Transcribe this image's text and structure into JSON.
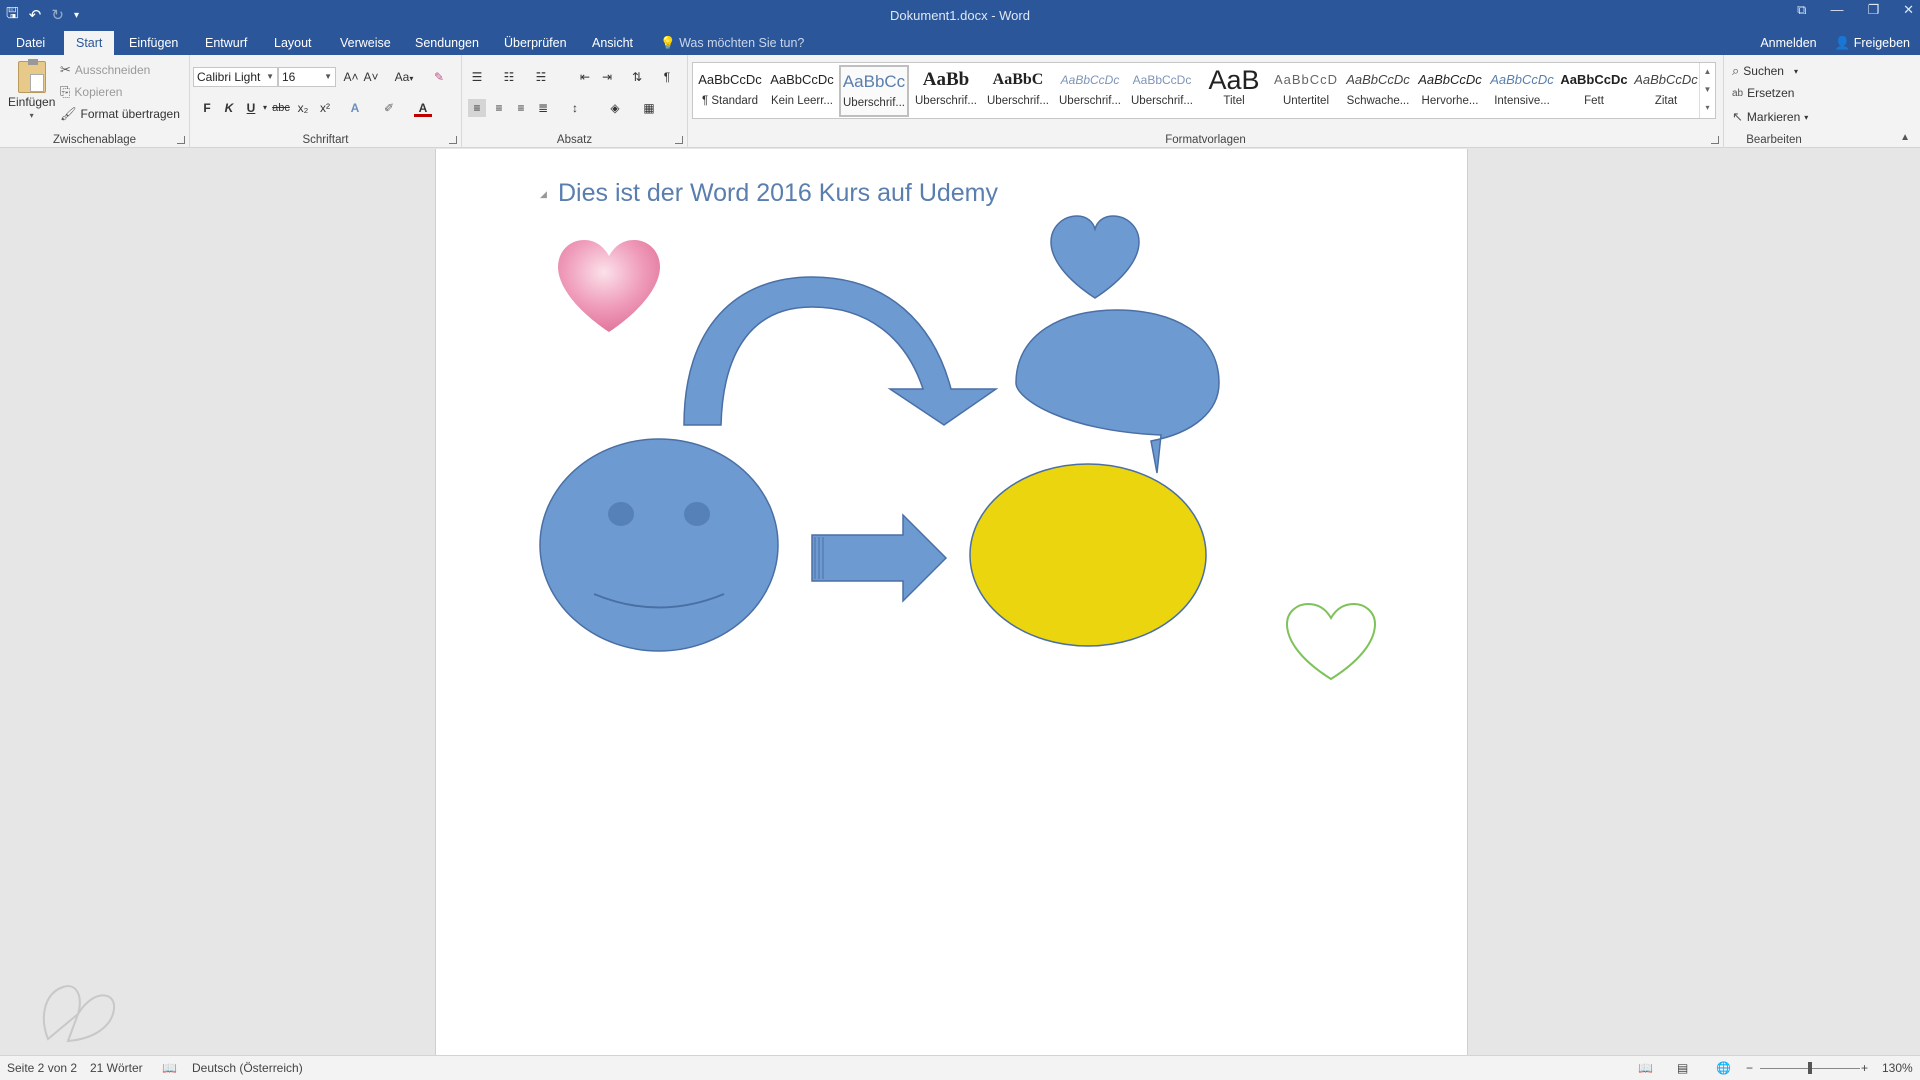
{
  "window": {
    "title": "Dokument1.docx - Word",
    "controls": [
      "restore-ribbon-icon",
      "minimize-icon",
      "maximize-icon",
      "close-icon"
    ]
  },
  "quick_access": {
    "save": "save-icon",
    "undo": "undo-icon",
    "redo": "redo-icon",
    "customize": "customize-icon"
  },
  "tabs": [
    "Datei",
    "Start",
    "Einfügen",
    "Entwurf",
    "Layout",
    "Verweise",
    "Sendungen",
    "Überprüfen",
    "Ansicht"
  ],
  "active_tab": "Start",
  "tell_me": "Was möchten Sie tun?",
  "account": {
    "signin": "Anmelden",
    "share": "Freigeben"
  },
  "clipboard": {
    "label": "Zwischenablage",
    "paste": "Einfügen",
    "cut": "Ausschneiden",
    "copy": "Kopieren",
    "format_painter": "Format übertragen"
  },
  "font": {
    "label": "Schriftart",
    "name": "Calibri Light",
    "size": "16",
    "bold": "F",
    "italic": "K",
    "underline": "U",
    "strike": "abc",
    "subscript": "x₂",
    "superscript": "x²",
    "grow": "A˄",
    "shrink": "A˅",
    "case": "Aa",
    "color_accent": "#c00000"
  },
  "paragraph": {
    "label": "Absatz"
  },
  "styles": {
    "label": "Formatvorlagen",
    "items": [
      {
        "sample": "AaBbCcDc",
        "name": "¶ Standard"
      },
      {
        "sample": "AaBbCcDc",
        "name": "Kein Leerr..."
      },
      {
        "sample": "AaBbCc",
        "name": "Überschrif..."
      },
      {
        "sample": "AaBb",
        "name": "Überschrif..."
      },
      {
        "sample": "AaBbC",
        "name": "Überschrif..."
      },
      {
        "sample": "AaBbCcDc",
        "name": "Überschrif..."
      },
      {
        "sample": "AaBbCcDc",
        "name": "Überschrif..."
      },
      {
        "sample": "AaB",
        "name": "Titel"
      },
      {
        "sample": "AaBbCcD",
        "name": "Untertitel"
      },
      {
        "sample": "AaBbCcDc",
        "name": "Schwache..."
      },
      {
        "sample": "AaBbCcDc",
        "name": "Hervorhe..."
      },
      {
        "sample": "AaBbCcDc",
        "name": "Intensive..."
      },
      {
        "sample": "AaBbCcDc",
        "name": "Fett"
      },
      {
        "sample": "AaBbCcDc",
        "name": "Zitat"
      }
    ]
  },
  "editing": {
    "label": "Bearbeiten",
    "find": "Suchen",
    "replace": "Ersetzen",
    "select": "Markieren"
  },
  "document": {
    "heading": "Dies ist der Word 2016 Kurs auf Udemy",
    "shapes": [
      "pink-heart",
      "curved-arrow",
      "blue-heart",
      "speech-bubble",
      "smiley-face",
      "right-arrow",
      "yellow-oval",
      "outline-heart"
    ],
    "colors": {
      "shape_blue": "#6d9bd1",
      "shape_stroke": "#4a6fa5",
      "yellow": "#ead50f",
      "pink": "#e97aa1",
      "green": "#7ec25a"
    }
  },
  "status": {
    "page": "Seite 2 von 2",
    "words": "21 Wörter",
    "language": "Deutsch (Österreich)",
    "zoom": "130%"
  }
}
